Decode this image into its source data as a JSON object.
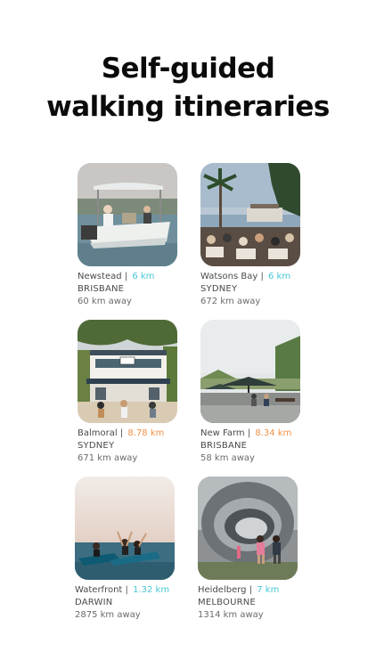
{
  "title": {
    "line1": "Self-guided",
    "line2": "walking itineraries"
  },
  "colors": {
    "teal": "#47c8d6",
    "orange": "#f0914a"
  },
  "items": [
    {
      "suburb": "Newstead",
      "separator": "|",
      "distance": "6 km",
      "distance_color": "#47c8d6",
      "city": "BRISBANE",
      "away": "60 km away",
      "image": "boat-on-river"
    },
    {
      "suburb": "Watsons Bay",
      "separator": "|",
      "distance": "6 km",
      "distance_color": "#47c8d6",
      "city": "SYDNEY",
      "away": "672 km away",
      "image": "waterfront-restaurant-palm"
    },
    {
      "suburb": "Balmoral",
      "separator": "|",
      "distance": "8.78 km",
      "distance_color": "#f0914a",
      "city": "SYDNEY",
      "away": "671 km away",
      "image": "beach-kiosk-building"
    },
    {
      "suburb": "New Farm",
      "separator": "|",
      "distance": "8.34 km",
      "distance_color": "#f0914a",
      "city": "BRISBANE",
      "away": "58 km away",
      "image": "riverside-park-umbrellas"
    },
    {
      "suburb": "Waterfront",
      "separator": "|",
      "distance": "1.32 km",
      "distance_color": "#47c8d6",
      "city": "DARWIN",
      "away": "2875 km away",
      "image": "jetski-riders"
    },
    {
      "suburb": "Heidelberg",
      "separator": "|",
      "distance": "7 km",
      "distance_color": "#47c8d6",
      "city": "MELBOURNE",
      "away": "1314 km away",
      "image": "steel-ring-sculpture"
    }
  ]
}
